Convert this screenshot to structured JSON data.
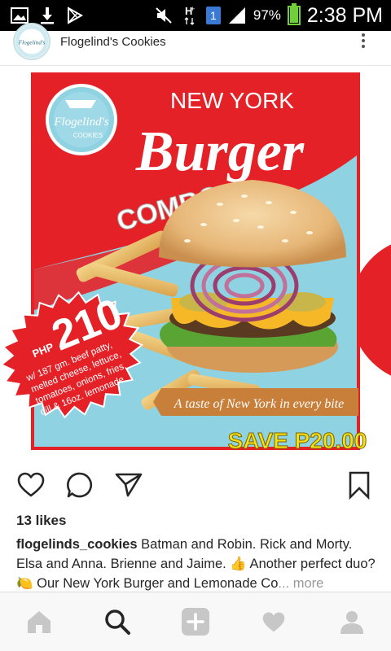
{
  "status_bar": {
    "battery_percent": "97%",
    "battery_level": 0.97,
    "sim_slot": "1",
    "time": "2:38 PM",
    "icons": [
      "image-icon",
      "download-icon",
      "play-store-icon",
      "mute-icon",
      "h-plus-icon",
      "signal-icon",
      "battery-icon"
    ]
  },
  "post": {
    "username": "Flogelind's Cookies",
    "avatar_text": "Flogelind's",
    "image": {
      "brand": "Flogelind's",
      "brand_sub": "COOKIES",
      "headline_top": "NEW YORK",
      "headline_main": "Burger",
      "headline_sub": "COMBO",
      "price_currency": "PHP",
      "price_value": "210",
      "description_lines": [
        "w/ 187 gm. beef patty,",
        "melted cheese, lettuce,",
        "tomatoes, onions, fries,",
        "dill & 16oz. lemonade"
      ],
      "tagline": "A taste of New York in every bite",
      "save_text": "SAVE P20.00",
      "colors": {
        "red": "#e52128",
        "sky": "#8fd2e2",
        "gold": "#f7e018",
        "white": "#ffffff"
      }
    },
    "likes": "13 likes",
    "caption": {
      "user": "flogelinds_cookies",
      "text": " Batman and Robin. Rick and Morty. Elsa and Anna. Brienne and Jaime. 👍 Another perfect duo? 🍋 Our New York Burger and Lemonade Co",
      "more": "... more"
    }
  },
  "nav": {
    "items": [
      "home-icon",
      "search-icon",
      "add-post-icon",
      "activity-heart-icon",
      "profile-icon"
    ]
  }
}
